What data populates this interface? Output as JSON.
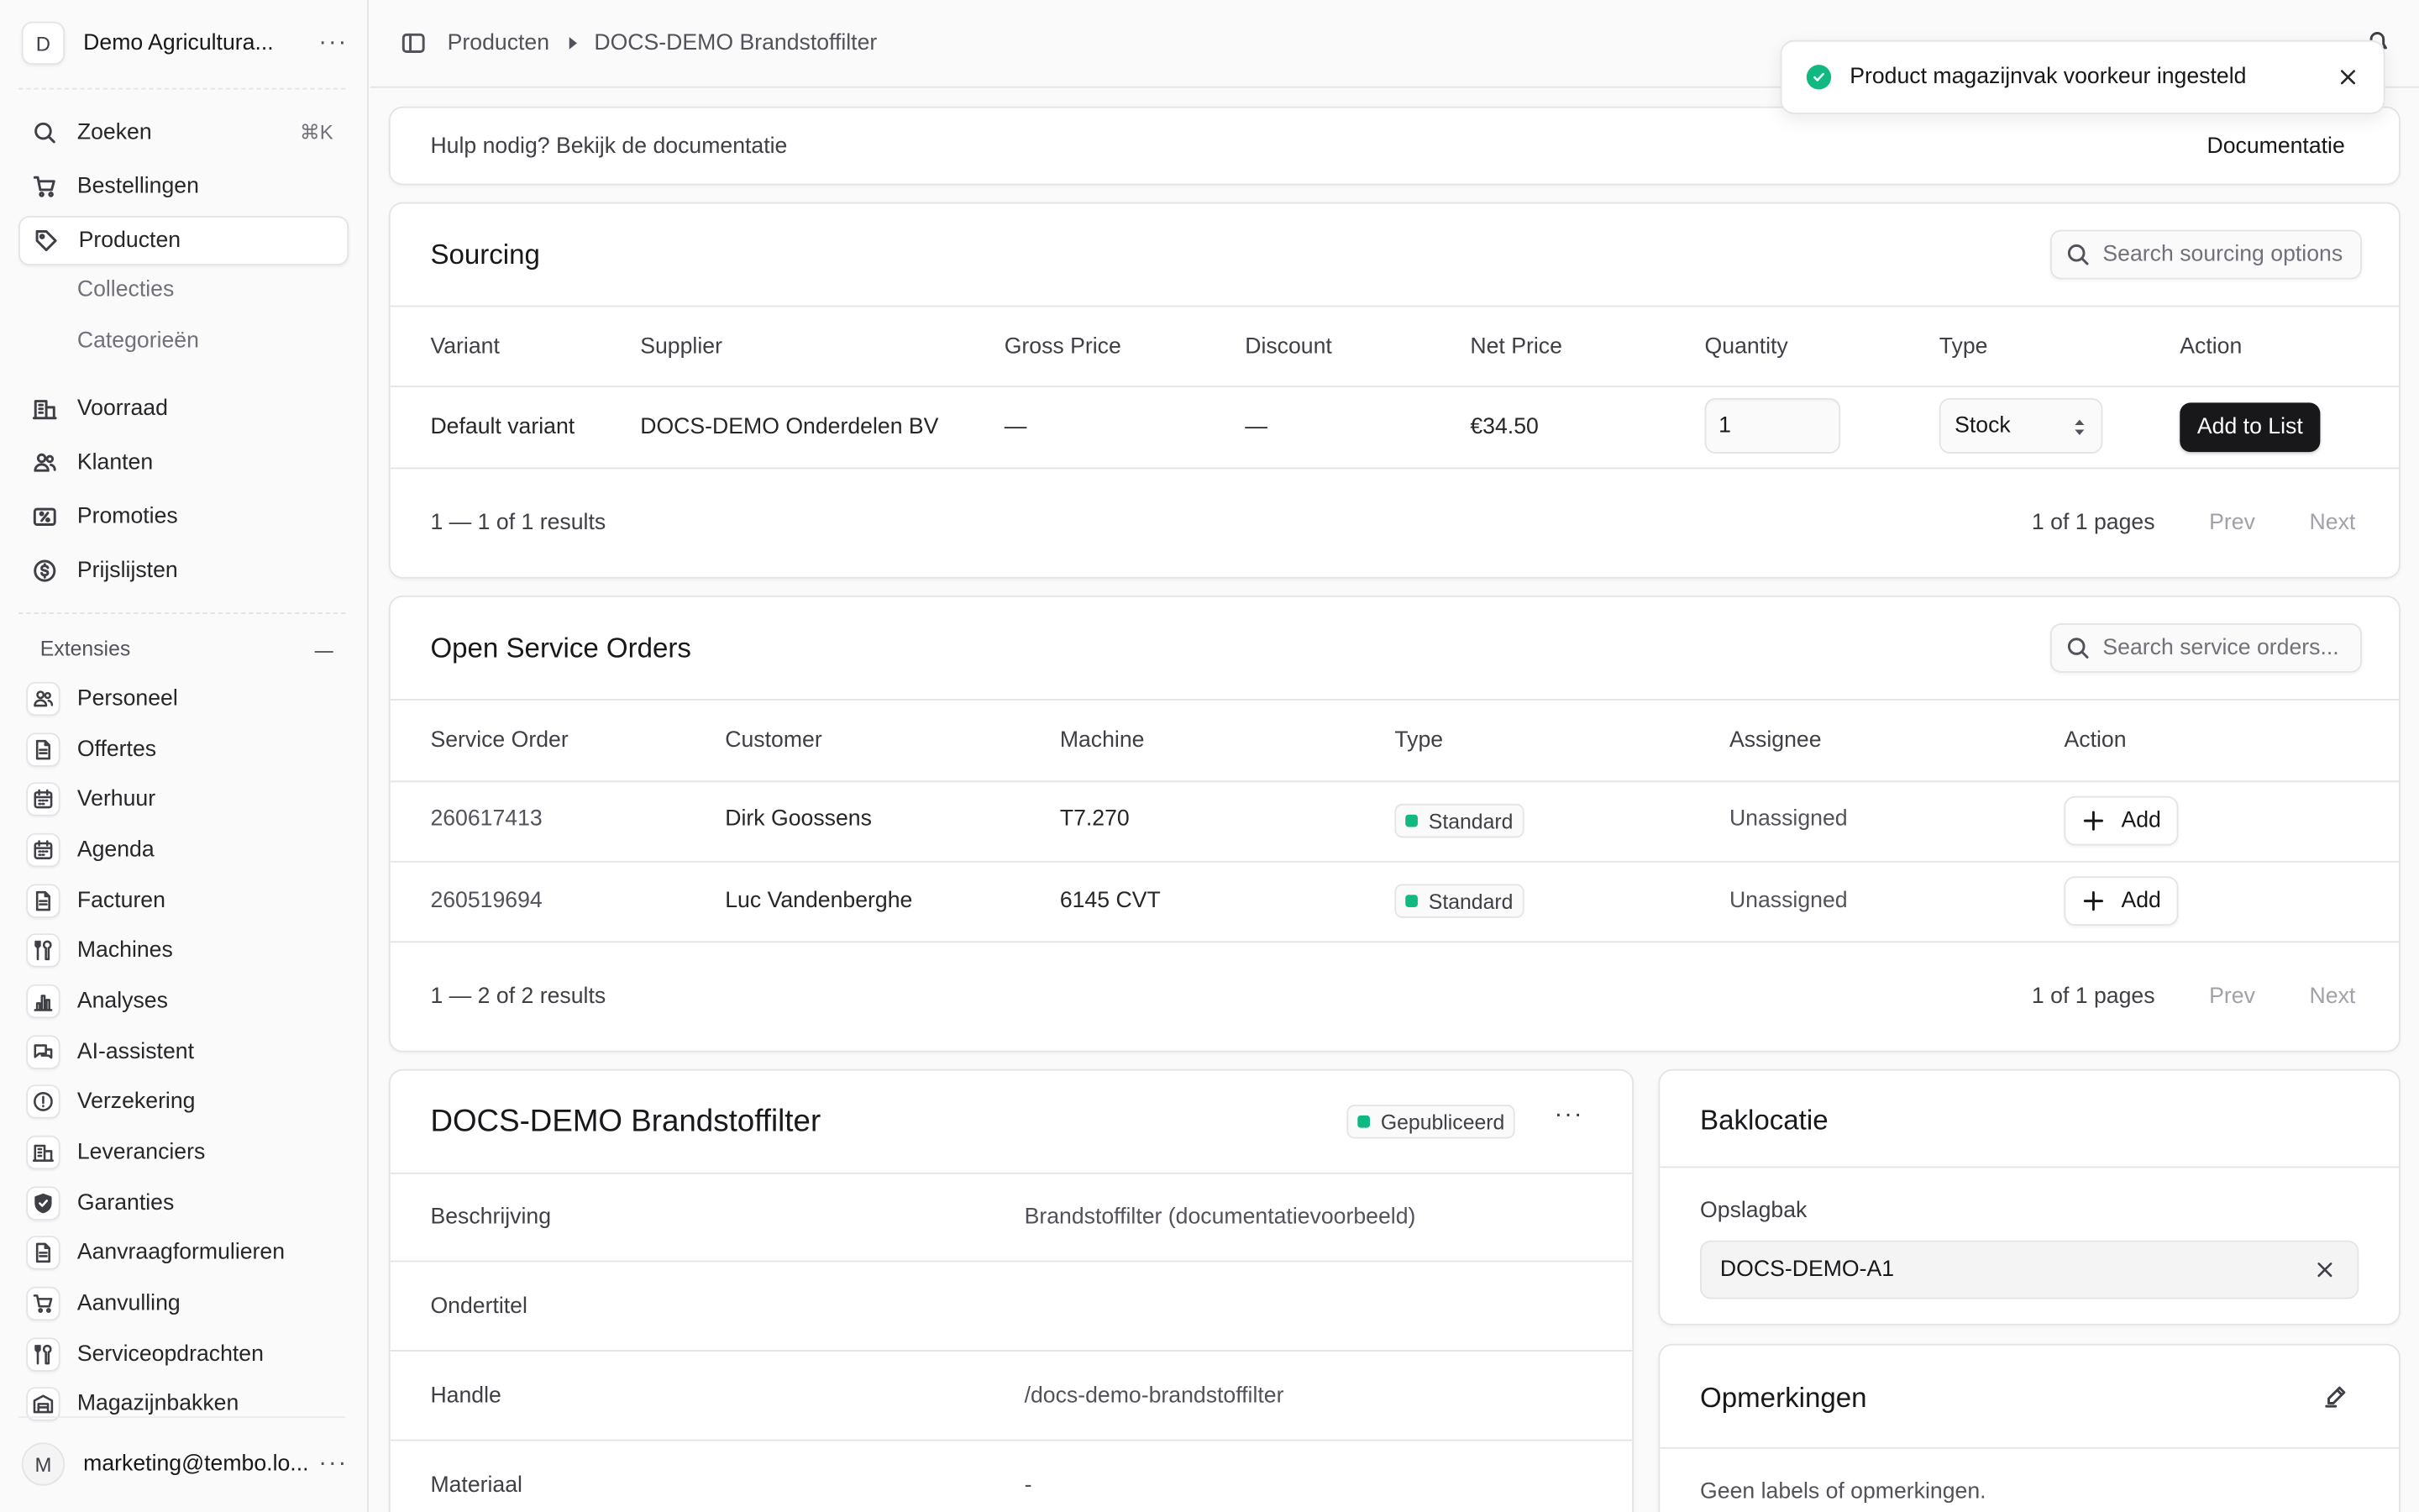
{
  "sidebar": {
    "store_initial": "D",
    "store_name": "Demo Agricultura...",
    "search_label": "Zoeken",
    "search_shortcut": "⌘K",
    "items": [
      {
        "label": "Bestellingen",
        "icon": "cart-icon"
      },
      {
        "label": "Producten",
        "icon": "tag-icon"
      },
      {
        "label": "Voorraad",
        "icon": "building-icon"
      },
      {
        "label": "Klanten",
        "icon": "users-icon"
      },
      {
        "label": "Promoties",
        "icon": "receipt-percent-icon"
      },
      {
        "label": "Prijslijsten",
        "icon": "currency-dollar-icon"
      }
    ],
    "product_subitems": [
      "Collecties",
      "Categorieën"
    ],
    "extensions_heading": "Extensies",
    "extensions": [
      {
        "label": "Personeel",
        "icon": "users-icon"
      },
      {
        "label": "Offertes",
        "icon": "document-icon"
      },
      {
        "label": "Verhuur",
        "icon": "calendar-icon"
      },
      {
        "label": "Agenda",
        "icon": "calendar-icon"
      },
      {
        "label": "Facturen",
        "icon": "document-icon"
      },
      {
        "label": "Machines",
        "icon": "tools-icon"
      },
      {
        "label": "Analyses",
        "icon": "bar-chart-icon"
      },
      {
        "label": "AI-assistent",
        "icon": "chat-bubbles-icon"
      },
      {
        "label": "Verzekering",
        "icon": "exclamation-circle-icon"
      },
      {
        "label": "Leveranciers",
        "icon": "building-icon"
      },
      {
        "label": "Garanties",
        "icon": "shield-check-icon"
      },
      {
        "label": "Aanvraagformulieren",
        "icon": "document-icon"
      },
      {
        "label": "Aanvulling",
        "icon": "cart-icon"
      },
      {
        "label": "Serviceopdrachten",
        "icon": "tools-icon"
      },
      {
        "label": "Magazijnbakken",
        "icon": "warehouse-icon"
      }
    ],
    "user_initial": "M",
    "user_email": "marketing@tembo.lo..."
  },
  "topbar": {
    "breadcrumb": [
      "Producten",
      "DOCS-DEMO Brandstoffilter"
    ]
  },
  "toast": {
    "message": "Product magazijnvak voorkeur ingesteld"
  },
  "help": {
    "text": "Hulp nodig? Bekijk de documentatie",
    "link": "Documentatie"
  },
  "sourcing": {
    "title": "Sourcing",
    "search_placeholder": "Search sourcing options",
    "columns": [
      "Variant",
      "Supplier",
      "Gross Price",
      "Discount",
      "Net Price",
      "Quantity",
      "Type",
      "Action"
    ],
    "rows": [
      {
        "variant": "Default variant",
        "supplier": "DOCS-DEMO Onderdelen BV",
        "gross": "—",
        "discount": "—",
        "net": "€34.50",
        "quantity": "1",
        "type": "Stock",
        "action": "Add to List"
      }
    ],
    "results": "1 — 1 of 1 results",
    "pages": "1 of 1 pages",
    "prev": "Prev",
    "next": "Next"
  },
  "service_orders": {
    "title": "Open Service Orders",
    "search_placeholder": "Search service orders...",
    "columns": [
      "Service Order",
      "Customer",
      "Machine",
      "Type",
      "Assignee",
      "Action"
    ],
    "rows": [
      {
        "order": "260617413",
        "customer": "Dirk Goossens",
        "machine": "T7.270",
        "type": "Standard",
        "assignee": "Unassigned",
        "action": "Add"
      },
      {
        "order": "260519694",
        "customer": "Luc Vandenberghe",
        "machine": "6145 CVT",
        "type": "Standard",
        "assignee": "Unassigned",
        "action": "Add"
      }
    ],
    "results": "1 — 2 of 2 results",
    "pages": "1 of 1 pages",
    "prev": "Prev",
    "next": "Next"
  },
  "product": {
    "title": "DOCS-DEMO Brandstoffilter",
    "status": "Gepubliceerd",
    "fields": [
      {
        "label": "Beschrijving",
        "value": "Brandstoffilter (documentatievoorbeeld)"
      },
      {
        "label": "Ondertitel",
        "value": ""
      },
      {
        "label": "Handle",
        "value": "/docs-demo-brandstoffilter"
      },
      {
        "label": "Materiaal",
        "value": "-"
      }
    ]
  },
  "bin_location": {
    "title": "Baklocatie",
    "field_label": "Opslagbak",
    "value": "DOCS-DEMO-A1"
  },
  "notes": {
    "title": "Opmerkingen",
    "empty": "Geen labels of opmerkingen."
  },
  "colors": {
    "accent_green": "#10b981",
    "dark_button": "#18181b",
    "border": "#e4e4e7"
  }
}
